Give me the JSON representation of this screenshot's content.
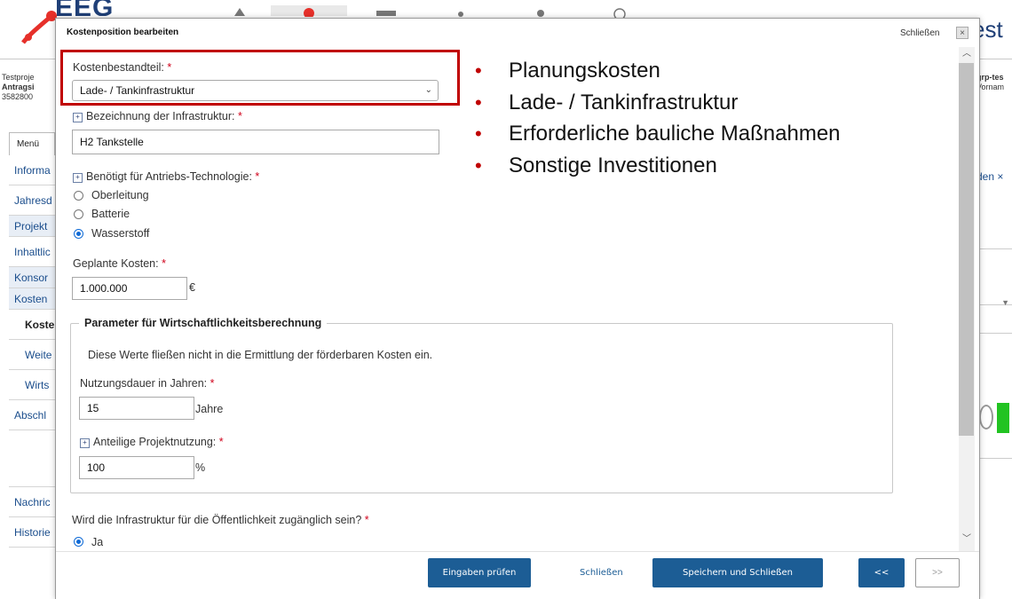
{
  "background": {
    "logo_text": "EEG",
    "right_title": "est",
    "left_info": [
      "Testproje",
      "Antragsi",
      "3582800"
    ],
    "right_info": [
      "grp-tes",
      "Vornam"
    ],
    "menu_tab": "Menü",
    "menu_items": [
      {
        "label": "Informa",
        "type": "link"
      },
      {
        "label": "Jahresd",
        "type": "link"
      },
      {
        "label": "Projekt",
        "type": "shaded"
      },
      {
        "label": "Inhaltlic",
        "type": "link"
      },
      {
        "label": "Konsor",
        "type": "shaded"
      },
      {
        "label": "Kosten",
        "type": "shaded"
      },
      {
        "label": "Koste",
        "type": "bold"
      },
      {
        "label": "Weite",
        "type": "sub"
      },
      {
        "label": "Wirts",
        "type": "sub"
      },
      {
        "label": "Abschl",
        "type": "link"
      },
      {
        "label": "",
        "type": "spacer"
      },
      {
        "label": "Nachric",
        "type": "link"
      },
      {
        "label": "Historie",
        "type": "link"
      }
    ],
    "right_link": "den ×"
  },
  "modal": {
    "title": "Kostenposition bearbeiten",
    "close_label": "Schließen",
    "close_icon": "×",
    "cost_component": {
      "label": "Kostenbestandteil:",
      "required": "*",
      "value": "Lade- / Tankinfrastruktur"
    },
    "infra_name": {
      "label": "Bezeichnung der Infrastruktur:",
      "required": "*",
      "value": "H2 Tankstelle"
    },
    "technology": {
      "label": "Benötigt für Antriebs-Technologie:",
      "required": "*",
      "options": [
        "Oberleitung",
        "Batterie",
        "Wasserstoff"
      ],
      "selected": "Wasserstoff"
    },
    "planned_cost": {
      "label": "Geplante Kosten:",
      "required": "*",
      "value": "1.000.000",
      "unit": "€"
    },
    "params": {
      "legend": "Parameter für Wirtschaftlichkeitsberechnung",
      "note": "Diese Werte fließen nicht in die Ermittlung der förderbaren Kosten ein.",
      "usage_years": {
        "label": "Nutzungsdauer in Jahren:",
        "required": "*",
        "value": "15",
        "unit": "Jahre"
      },
      "project_share": {
        "label": "Anteilige Projektnutzung:",
        "required": "*",
        "value": "100",
        "unit": "%"
      }
    },
    "public_access": {
      "question": "Wird die Infrastruktur für die Öffentlichkeit zugänglich sein?",
      "required": "*",
      "first_option": "Ja"
    },
    "footer": {
      "check": "Eingaben prüfen",
      "close": "Schließen",
      "save_close": "Speichern und Schließen",
      "prev": "<<",
      "next": ">>"
    }
  },
  "annotation": {
    "bullets": [
      "Planungskosten",
      "Lade- / Tankinfrastruktur",
      "Erforderliche bauliche Maßnahmen",
      "Sonstige Investitionen"
    ],
    "bullet_char": "•"
  },
  "colors": {
    "brand_blue": "#1c5d95",
    "required_red": "#d0021b",
    "annotation_red": "#c00000",
    "radio_blue": "#0f6ad6"
  }
}
